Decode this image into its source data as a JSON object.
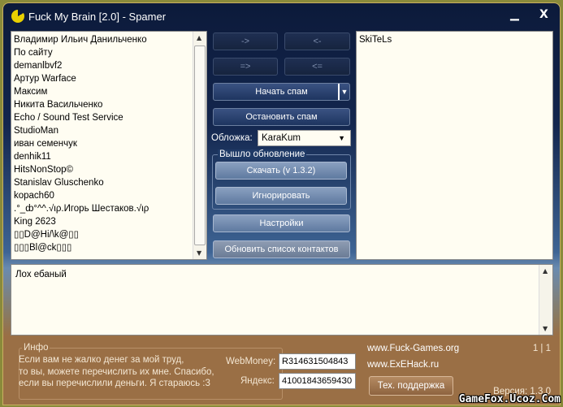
{
  "window": {
    "title": "Fuck My Brain [2.0] - Spamer",
    "minimize": "▁",
    "close": "X"
  },
  "contacts": [
    "Владимир Ильич Данильченко",
    "По сайту",
    "demanlbvf2",
    "Артур Warface",
    "Максим",
    "Никита Васильченко",
    "Echo / Sound Test Service",
    "StudioMan",
    "иван семенчук",
    "denhik11",
    "HitsNonStop©",
    "Stanislav Gluschenko",
    "kopach60",
    ".°_ȸ°^^.√ιρ.Игорь Шестаков.√ιρ",
    "King 2623",
    "▯▯D@Hi/\\k@▯▯",
    "▯▯▯Bl@ck▯▯▯"
  ],
  "selected": [
    "SkiTeLs"
  ],
  "buttons": {
    "add_one": "->",
    "remove_one": "<-",
    "add_all": "=>",
    "remove_all": "<=",
    "start": "Начать спам",
    "stop": "Остановить спам",
    "download": "Скачать (v 1.3.2)",
    "ignore": "Игнорировать",
    "settings": "Настройки",
    "refresh": "Обновить список контактов",
    "support": "Тех. поддержка"
  },
  "skin": {
    "label": "Обложка:",
    "value": "KaraKum"
  },
  "update": {
    "label": "Вышло обновление"
  },
  "message": "Лох ебаный",
  "info": {
    "title": "Инфо",
    "lines": [
      "Если вам не жалко денег за мой труд,",
      "то вы, можете перечислить их мне. Спасибо,",
      "если вы перечислили деньги. Я стараюсь :3"
    ],
    "webmoney_label": "WebMoney:",
    "webmoney": "R314631504843",
    "yandex_label": "Яндекс:",
    "yandex": "410018436594З0"
  },
  "links": [
    "www.Fuck-Games.org",
    "www.ExEHack.ru"
  ],
  "counter": "1 | 1",
  "version": "Версия: 1.3.0",
  "watermark": "GameFox.Ucoz.Com"
}
